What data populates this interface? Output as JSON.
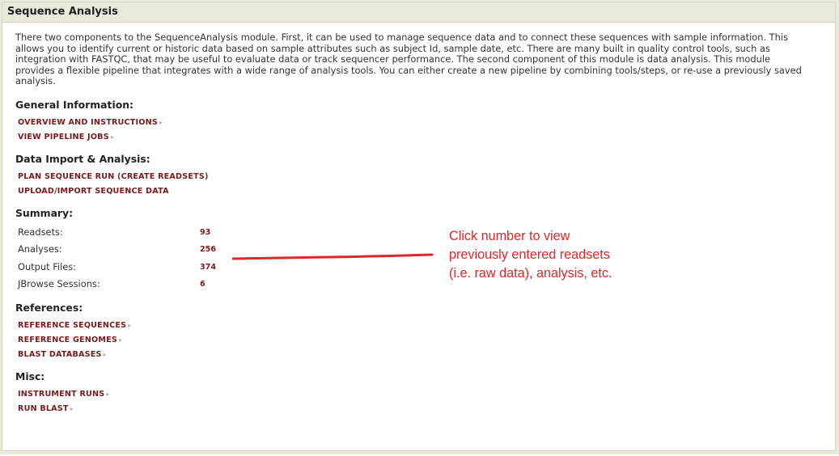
{
  "panel": {
    "title": "Sequence Analysis",
    "intro": "There two components to the SequenceAnalysis module. First, it can be used to manage sequence data and to connect these sequences with sample information. This allows you to identify current or historic data based on sample attributes such as subject Id, sample date, etc. There are many built in quality control tools, such as integration with FASTQC, that may be useful to evaluate data or track sequencer performance. The second component of this module is data analysis. This module provides a flexible pipeline that integrates with a wide range of analysis tools. You can either create a new pipeline by combining tools/steps, or re-use a previously saved analysis."
  },
  "general": {
    "title": "General Information:",
    "links": [
      "OVERVIEW AND INSTRUCTIONS",
      "VIEW PIPELINE JOBS"
    ]
  },
  "import": {
    "title": "Data Import & Analysis:",
    "links": [
      "PLAN SEQUENCE RUN (CREATE READSETS)",
      "UPLOAD/IMPORT SEQUENCE DATA"
    ]
  },
  "summary": {
    "title": "Summary:",
    "rows": [
      {
        "label": "Readsets:",
        "count": "93"
      },
      {
        "label": "Analyses:",
        "count": "256"
      },
      {
        "label": "Output Files:",
        "count": "374"
      },
      {
        "label": "JBrowse Sessions:",
        "count": "6"
      }
    ]
  },
  "references": {
    "title": "References:",
    "links": [
      "REFERENCE SEQUENCES",
      "REFERENCE GENOMES",
      "BLAST DATABASES"
    ]
  },
  "misc": {
    "title": "Misc:",
    "links": [
      "INSTRUMENT RUNS",
      "RUN BLAST"
    ]
  },
  "annotation": {
    "lines": [
      "Click number to view",
      "previously entered readsets",
      "(i.e. raw data), analysis, etc."
    ]
  },
  "colors": {
    "link": "#7a1a1a",
    "header_bg": "#ebe9dc",
    "annotation": "#e0262a"
  },
  "icons": {
    "link_arrow": "triangle-right-icon"
  }
}
